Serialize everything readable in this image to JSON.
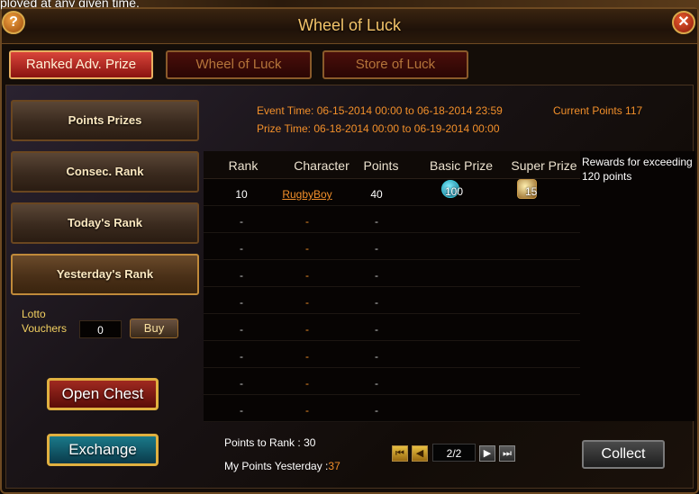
{
  "top_banner": {
    "text": "ployed at any given time."
  },
  "window": {
    "title": "Wheel of Luck",
    "help_label": "?",
    "close_label": "✕"
  },
  "tabs": [
    {
      "label": "Ranked Adv. Prize",
      "active": true
    },
    {
      "label": "Wheel of Luck",
      "active": false
    },
    {
      "label": "Store of Luck",
      "active": false
    }
  ],
  "sidebar": {
    "items": [
      {
        "label": "Points Prizes"
      },
      {
        "label": "Consec. Rank"
      },
      {
        "label": "Today's Rank"
      },
      {
        "label": "Yesterday's Rank"
      }
    ],
    "lotto_label_1": "Lotto",
    "lotto_label_2": "Vouchers",
    "lotto_value": "0",
    "buy_label": "Buy",
    "open_chest_label": "Open Chest",
    "exchange_label": "Exchange"
  },
  "event": {
    "event_time": "Event Time: 06-15-2014 00:00 to 06-18-2014 23:59",
    "prize_time": "Prize Time: 06-18-2014 00:00 to 06-19-2014 00:00",
    "current_points": "Current Points 117"
  },
  "table": {
    "headers": [
      "Rank",
      "Character",
      "Points",
      "Basic Prize",
      "Super Prize"
    ],
    "reward_note": "Rewards for exceeding 120 points",
    "first_row": {
      "rank": "10",
      "character": "RugbyBoy",
      "points": "40",
      "basic_prize": "100",
      "super_prize": "15"
    },
    "empty_rows": [
      [
        "-",
        "-",
        "-"
      ],
      [
        "-",
        "-",
        "-"
      ],
      [
        "-",
        "-",
        "-"
      ],
      [
        "-",
        "-",
        "-"
      ],
      [
        "-",
        "-",
        "-"
      ],
      [
        "-",
        "-",
        "-"
      ],
      [
        "-",
        "-",
        "-"
      ],
      [
        "-",
        "-",
        "-"
      ]
    ]
  },
  "footer": {
    "points_to_rank_label": "Points to Rank :",
    "points_to_rank_value": "30",
    "my_points_label": "My Points Yesterday :",
    "my_points_value": "37",
    "page": "2/2",
    "collect_label": "Collect"
  },
  "colors": {
    "accent": "#f28f2a",
    "title": "#f3c46a",
    "tab_active": "#d9443a"
  }
}
